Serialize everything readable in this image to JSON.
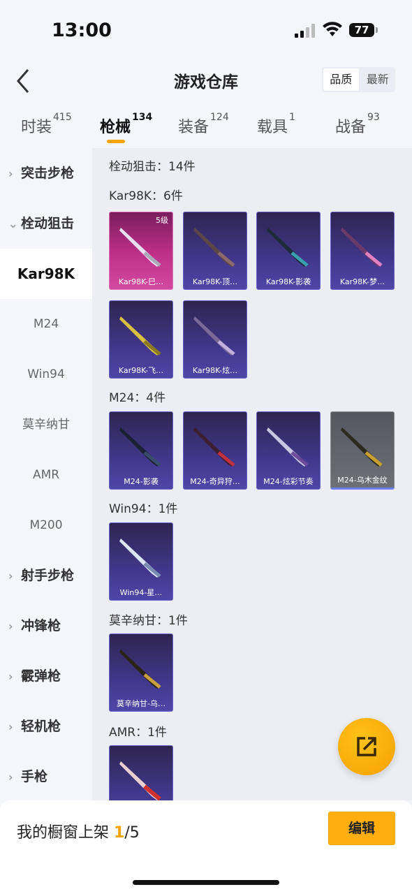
{
  "status": {
    "time": "13:00",
    "battery": "77"
  },
  "nav": {
    "title": "游戏仓库",
    "sort_quality": "品质",
    "sort_newest": "最新"
  },
  "tabs": [
    {
      "label": "时装",
      "count": "415"
    },
    {
      "label": "枪械",
      "count": "134"
    },
    {
      "label": "装备",
      "count": "124"
    },
    {
      "label": "载具",
      "count": "1"
    },
    {
      "label": "战备",
      "count": "93"
    }
  ],
  "sidebar": {
    "groups": [
      "突击步枪",
      "栓动狙击",
      "射手步枪",
      "冲锋枪",
      "霰弹枪",
      "轻机枪",
      "手枪"
    ],
    "subs": [
      "Kar98K",
      "M24",
      "Win94",
      "莫辛纳甘",
      "AMR",
      "M200"
    ]
  },
  "content": {
    "header": "栓动狙击：14件",
    "sections": [
      {
        "title": "Kar98K：6件",
        "items": [
          "Kar98K-巳…",
          "Kar98K-顶…",
          "Kar98K-影袭",
          "Kar98K-梦…",
          "Kar98K-飞…",
          "Kar98K-炫…"
        ],
        "level": "5级"
      },
      {
        "title": "M24：4件",
        "items": [
          "M24-影袭",
          "M24-奇异狩…",
          "M24-炫彩节奏",
          "M24-乌木金纹"
        ]
      },
      {
        "title": "Win94：1件",
        "items": [
          "Win94-星…"
        ]
      },
      {
        "title": "莫辛纳甘：1件",
        "items": [
          "莫辛纳甘-乌…"
        ]
      },
      {
        "title": "AMR：1件",
        "items": []
      }
    ]
  },
  "bottom": {
    "shelf_label": "我的橱窗上架",
    "shelf_current": "1",
    "shelf_total": "/5",
    "edit": "编辑"
  },
  "colors": {
    "accent": "#f5a300",
    "button": "#ffad0f",
    "card_purple": "#41378a",
    "card_pink": "#c0308a"
  }
}
